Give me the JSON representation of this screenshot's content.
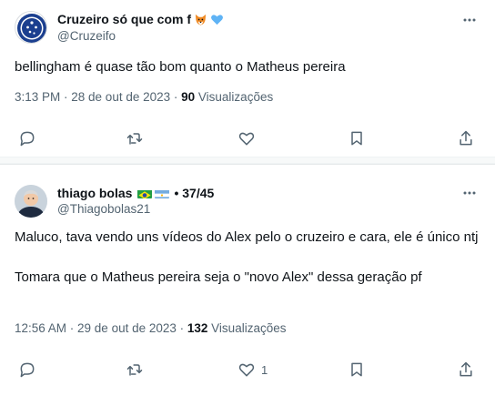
{
  "colors": {
    "text": "#0f1419",
    "secondary": "#536471",
    "separator": "#f7f9f9",
    "cruzeiro_blue": "#1b3f8f"
  },
  "tweet1": {
    "display_name": "Cruzeiro só que com f",
    "emoji_icons": [
      "fox-face-icon",
      "blue-heart-icon"
    ],
    "handle": "@Cruzeifo",
    "text": "bellingham é quase tão bom quanto o Matheus pereira",
    "time": "3:13 PM · 28 de out de 2023 · ",
    "views_count": "90",
    "views_label": " Visualizações",
    "actions": {
      "reply_count": "",
      "retweet_count": "",
      "like_count": ""
    }
  },
  "tweet2": {
    "display_name": "thiago bolas",
    "flags": [
      "brazil-flag-icon",
      "argentina-flag-icon"
    ],
    "name_suffix": "• 37/45",
    "handle": "@Thiagobolas21",
    "text": "Maluco, tava vendo uns vídeos do Alex pelo o cruzeiro e cara, ele é único ntj\n\nTomara que o Matheus pereira seja o \"novo Alex\" dessa geração pf",
    "time": "12:56 AM · 29 de out de 2023 · ",
    "views_count": "132",
    "views_label": " Visualizações",
    "actions": {
      "reply_count": "",
      "retweet_count": "",
      "like_count": "1"
    }
  }
}
